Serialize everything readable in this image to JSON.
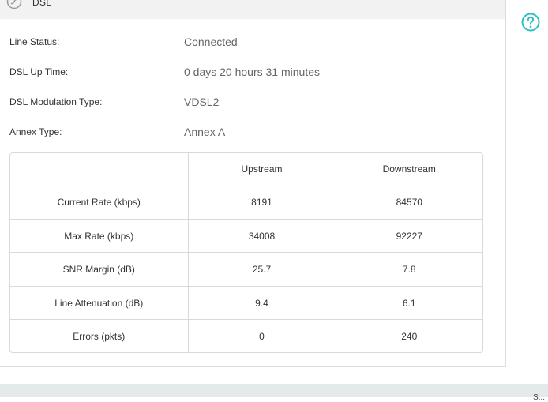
{
  "header": {
    "title": "DSL",
    "icon": "dsl-icon"
  },
  "info": [
    {
      "label": "Line Status:",
      "value": "Connected"
    },
    {
      "label": "DSL Up Time:",
      "value": "0 days 20 hours 31 minutes"
    },
    {
      "label": "DSL Modulation Type:",
      "value": "VDSL2"
    },
    {
      "label": "Annex Type:",
      "value": "Annex A"
    }
  ],
  "table": {
    "columns": [
      "",
      "Upstream",
      "Downstream"
    ],
    "rows": [
      [
        "Current Rate (kbps)",
        "8191",
        "84570"
      ],
      [
        "Max Rate (kbps)",
        "34008",
        "92227"
      ],
      [
        "SNR Margin (dB)",
        "25.7",
        "7.8"
      ],
      [
        "Line Attenuation (dB)",
        "9.4",
        "6.1"
      ],
      [
        "Errors (pkts)",
        "0",
        "240"
      ]
    ]
  },
  "help": {
    "icon": "help-icon",
    "color": "#2fbfc0"
  },
  "footer": {
    "text": "S..."
  },
  "colors": {
    "accent": "#2fbfc0",
    "header_bg": "#f2f2f2",
    "footer_bg": "#e4eaec"
  }
}
